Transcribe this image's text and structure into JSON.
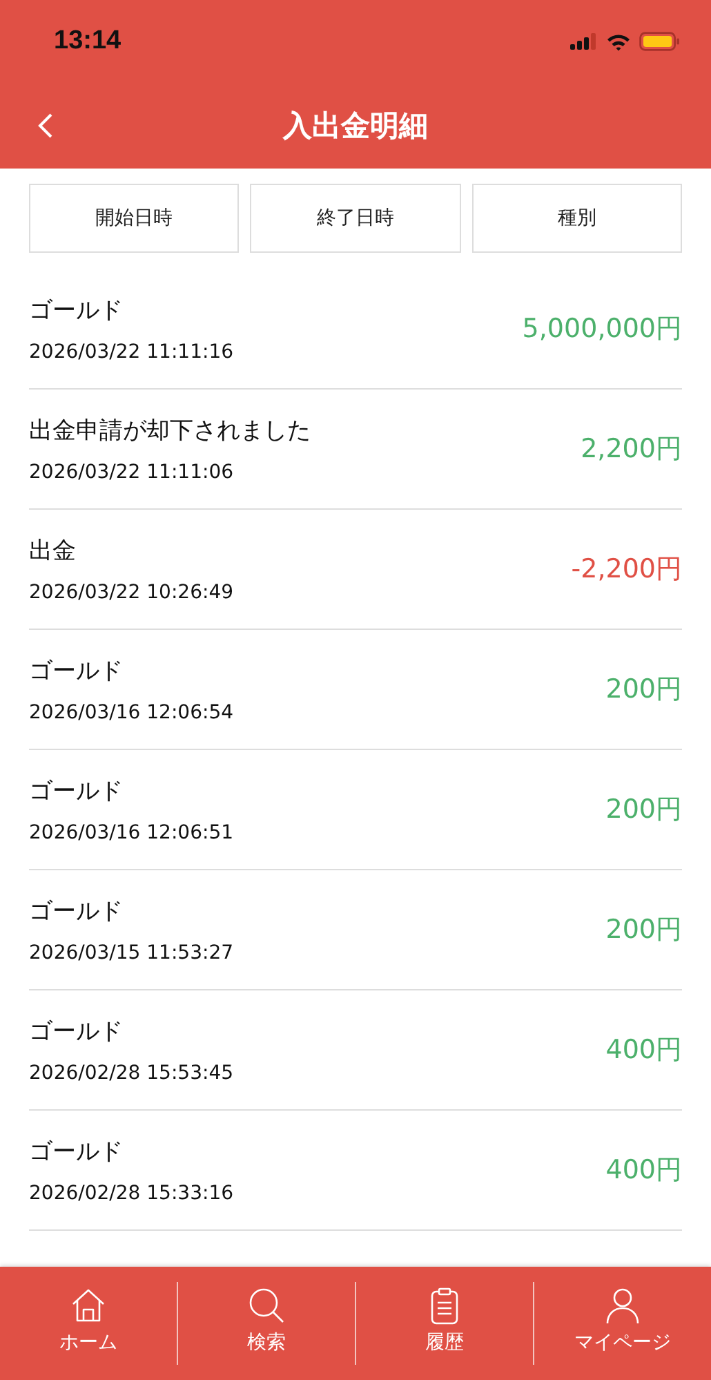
{
  "status_bar": {
    "time": "13:14"
  },
  "header": {
    "title": "入出金明細"
  },
  "filters": [
    {
      "label": "開始日時"
    },
    {
      "label": "終了日時"
    },
    {
      "label": "種別"
    }
  ],
  "transactions": [
    {
      "title": "ゴールド",
      "datetime": "2026/03/22 11:11:16",
      "amount": "5,000,000円",
      "kind": "in"
    },
    {
      "title": "出金申請が却下されました",
      "datetime": "2026/03/22 11:11:06",
      "amount": "2,200円",
      "kind": "in"
    },
    {
      "title": "出金",
      "datetime": "2026/03/22 10:26:49",
      "amount": "-2,200円",
      "kind": "out"
    },
    {
      "title": "ゴールド",
      "datetime": "2026/03/16 12:06:54",
      "amount": "200円",
      "kind": "in"
    },
    {
      "title": "ゴールド",
      "datetime": "2026/03/16 12:06:51",
      "amount": "200円",
      "kind": "in"
    },
    {
      "title": "ゴールド",
      "datetime": "2026/03/15 11:53:27",
      "amount": "200円",
      "kind": "in"
    },
    {
      "title": "ゴールド",
      "datetime": "2026/02/28 15:53:45",
      "amount": "400円",
      "kind": "in"
    },
    {
      "title": "ゴールド",
      "datetime": "2026/02/28 15:33:16",
      "amount": "400円",
      "kind": "in"
    }
  ],
  "tab_bar": [
    {
      "label": "ホーム",
      "kind": "home"
    },
    {
      "label": "検索",
      "kind": "search"
    },
    {
      "label": "履歴",
      "kind": "history"
    },
    {
      "label": "マイページ",
      "kind": "account"
    }
  ]
}
